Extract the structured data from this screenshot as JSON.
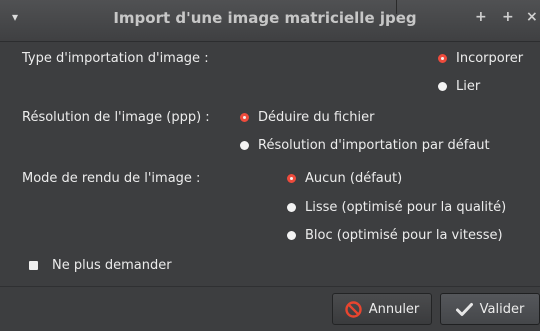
{
  "titlebar": {
    "title": "Import d'une image matricielle jpeg",
    "menu_glyph": "▾",
    "btn_minimize": "+",
    "btn_maximize": "+",
    "btn_close": "×"
  },
  "import_type": {
    "label": "Type d'importation d'image :",
    "options": [
      "Incorporer",
      "Lier"
    ],
    "selected": "Incorporer"
  },
  "resolution": {
    "label": "Résolution de l'image (ppp) :",
    "options": [
      "Déduire du fichier",
      "Résolution d'importation par défaut"
    ],
    "selected": "Déduire du fichier"
  },
  "render_mode": {
    "label": "Mode de rendu de l'image :",
    "options": [
      "Aucun (défaut)",
      "Lisse (optimisé pour la qualité)",
      "Bloc (optimisé pour la vitesse)"
    ],
    "selected": "Aucun (défaut)"
  },
  "dont_ask": {
    "label": "Ne plus demander",
    "checked": false
  },
  "buttons": {
    "cancel": {
      "label": "Annuler",
      "mnemonic": "n",
      "icon": "cancel-icon"
    },
    "ok": {
      "label": "Valider",
      "mnemonic": "V",
      "icon": "checkmark-icon"
    }
  },
  "colors": {
    "accent": "#ee4b3c",
    "background": "#3d3e40"
  }
}
